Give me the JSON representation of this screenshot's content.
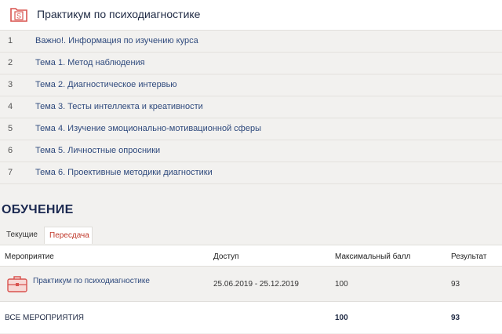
{
  "course": {
    "title": "Практикум по психодиагностике",
    "icon": "course-s-icon"
  },
  "topics": [
    {
      "num": "1",
      "title": "Важно!. Информация по изучению курса"
    },
    {
      "num": "2",
      "title": "Тема 1. Метод наблюдения"
    },
    {
      "num": "3",
      "title": "Тема 2. Диагностическое интервью"
    },
    {
      "num": "4",
      "title": "Тема 3. Тесты интеллекта и креативности"
    },
    {
      "num": "5",
      "title": "Тема 4. Изучение эмоционально-мотивационной сферы"
    },
    {
      "num": "6",
      "title": "Тема 5. Личностные опросники"
    },
    {
      "num": "7",
      "title": "Тема 6. Проективные методики диагностики"
    }
  ],
  "training": {
    "section_title": "ОБУЧЕНИЕ",
    "tabs": [
      {
        "label": "Текущие",
        "active": false
      },
      {
        "label": "Пересдача",
        "active": true
      }
    ],
    "columns": {
      "event": "Мероприятие",
      "access": "Доступ",
      "max": "Максимальный балл",
      "result": "Результат"
    },
    "rows": [
      {
        "event": "Практикум по психодиагностике",
        "access": "25.06.2019 - 25.12.2019",
        "max": "100",
        "result": "93",
        "icon": "briefcase-icon"
      }
    ],
    "total": {
      "label": "ВСЕ МЕРОПРИЯТИЯ",
      "max": "100",
      "result": "93"
    }
  },
  "colors": {
    "accent_red": "#d9534f",
    "link_blue": "#2f4a7d",
    "heading_navy": "#1a2850"
  }
}
